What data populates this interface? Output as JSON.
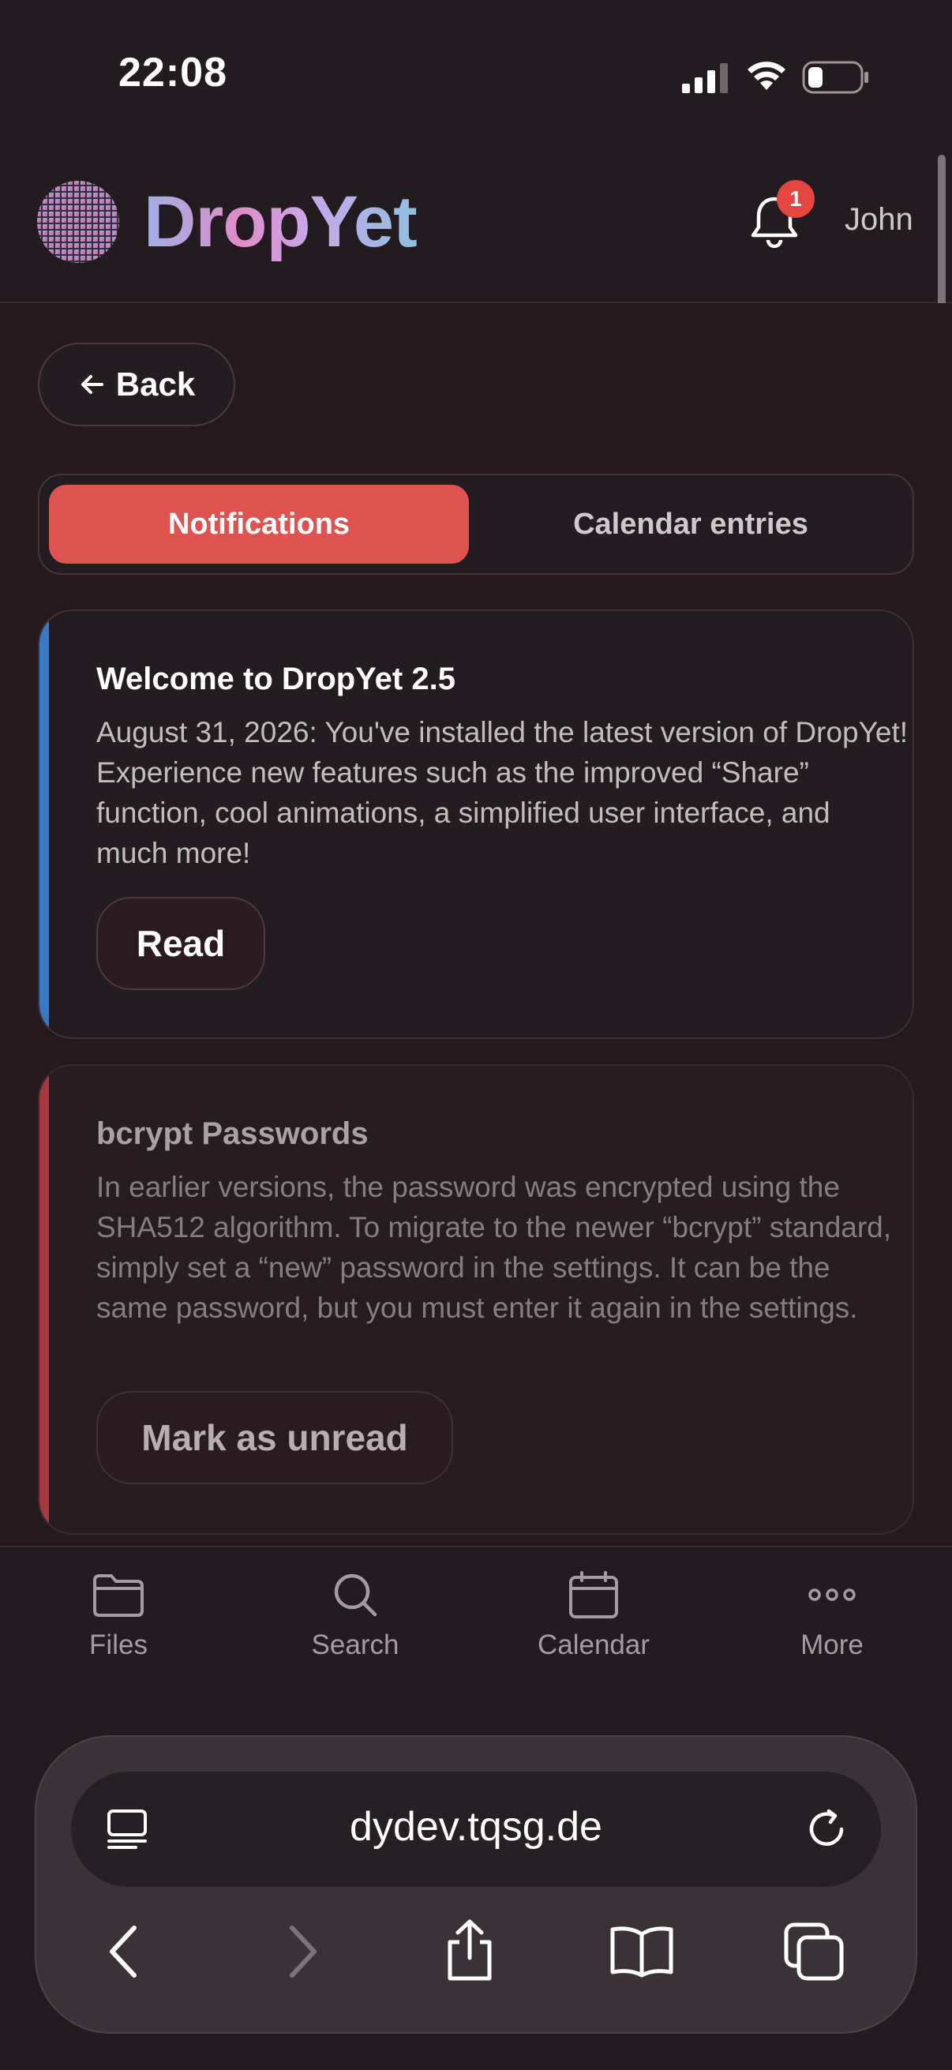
{
  "status_bar": {
    "time": "22:08"
  },
  "header": {
    "brand": "DropYet",
    "notification_count": "1",
    "user_name": "John"
  },
  "back_button": {
    "label": "Back"
  },
  "tabs": [
    {
      "label": "Notifications",
      "active": true
    },
    {
      "label": "Calendar entries",
      "active": false
    }
  ],
  "notifications": [
    {
      "title": "Welcome to DropYet 2.5",
      "body": "August 31, 2026: You've installed the latest version of DropYet! Experience new features such as the improved “Share” function, cool animations, a simplified user interface, and much more!",
      "action": "Read",
      "accent": "#3778c9"
    },
    {
      "title": "bcrypt Passwords",
      "body": "In earlier versions, the password was encrypted using the SHA512 algorithm. To migrate to the newer “bcrypt” standard, simply set a “new” password in the settings. It can be the same password, but you must enter it again in the settings.",
      "action": "Mark as unread",
      "accent": "#a8363a"
    }
  ],
  "bottom_nav": [
    {
      "label": "Files",
      "icon": "folder-icon"
    },
    {
      "label": "Search",
      "icon": "search-icon"
    },
    {
      "label": "Calendar",
      "icon": "calendar-icon"
    },
    {
      "label": "More",
      "icon": "more-icon"
    }
  ],
  "browser": {
    "url": "dydev.tqsg.de"
  },
  "colors": {
    "accent": "#de5250",
    "badge": "#e5453f"
  }
}
